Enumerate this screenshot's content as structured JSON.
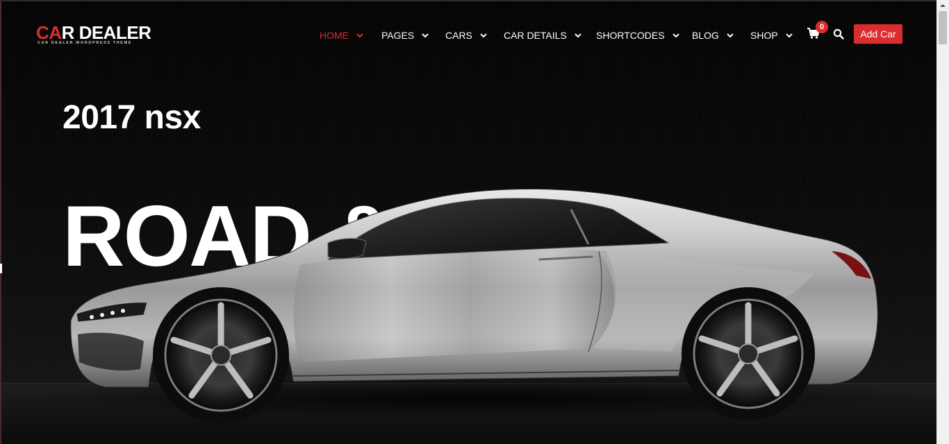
{
  "brand": {
    "logo_red_1": "C",
    "logo_red_2": "A",
    "logo_white_1": "R DEALER",
    "tagline": "CAR DEALER WORDPRESS THEME",
    "accent_color": "#db2d2e"
  },
  "nav": {
    "items": [
      {
        "label": "HOME",
        "active": true
      },
      {
        "label": "PAGES",
        "active": false
      },
      {
        "label": "CARS",
        "active": false
      },
      {
        "label": "CAR DETAILS",
        "active": false
      },
      {
        "label": "SHORTCODES",
        "active": false
      },
      {
        "label": "BLOG",
        "active": false
      },
      {
        "label": "SHOP",
        "active": false
      }
    ],
    "cart_count": "0",
    "add_car_label": "Add Car"
  },
  "hero": {
    "subtitle": "2017 nsx",
    "title": "ROAD &"
  },
  "icons": {
    "cart": "cart-icon",
    "search": "search-icon",
    "chevron": "chevron-down-icon"
  }
}
